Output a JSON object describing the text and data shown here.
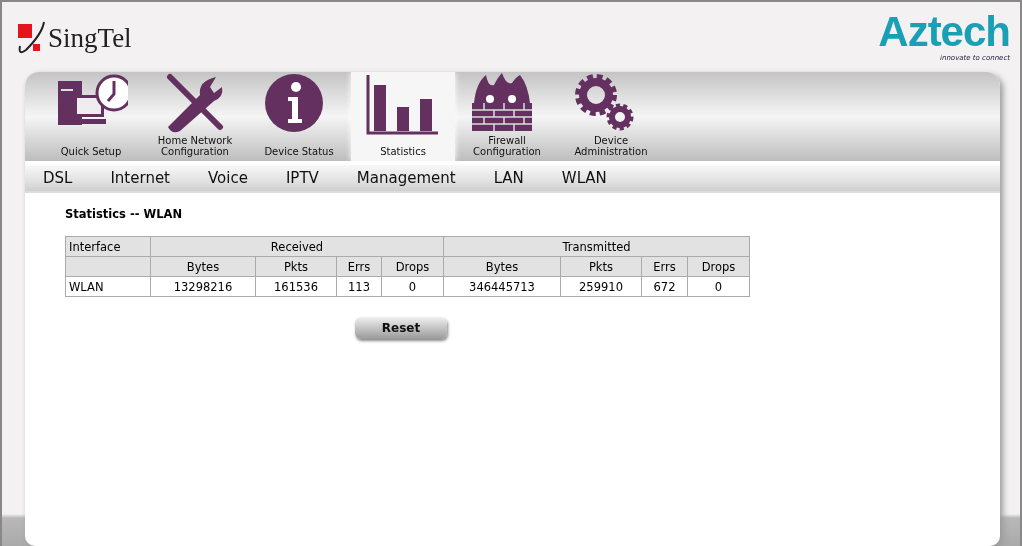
{
  "header": {
    "left_logo": "SingTel",
    "right_logo": "Aztech",
    "right_tagline": "innovate to connect"
  },
  "tabs": [
    {
      "label": "Quick Setup",
      "kind": "setup",
      "selected": false
    },
    {
      "label": "Home Network Configuration",
      "kind": "tools",
      "selected": false
    },
    {
      "label": "Device Status",
      "kind": "info",
      "selected": false
    },
    {
      "label": "Statistics",
      "kind": "chart",
      "selected": true
    },
    {
      "label": "Firewall Configuration",
      "kind": "firewall",
      "selected": false
    },
    {
      "label": "Device Administration",
      "kind": "gears",
      "selected": false
    }
  ],
  "subnav": [
    "DSL",
    "Internet",
    "Voice",
    "IPTV",
    "Management",
    "LAN",
    "WLAN"
  ],
  "page_title": "Statistics -- WLAN",
  "table": {
    "group_headers": [
      "Interface",
      "Received",
      "Transmitted"
    ],
    "columns": [
      "",
      "Bytes",
      "Pkts",
      "Errs",
      "Drops",
      "Bytes",
      "Pkts",
      "Errs",
      "Drops"
    ],
    "rows": [
      [
        "WLAN",
        "13298216",
        "161536",
        "113",
        "0",
        "346445713",
        "259910",
        "672",
        "0"
      ]
    ]
  },
  "reset_button": "Reset"
}
